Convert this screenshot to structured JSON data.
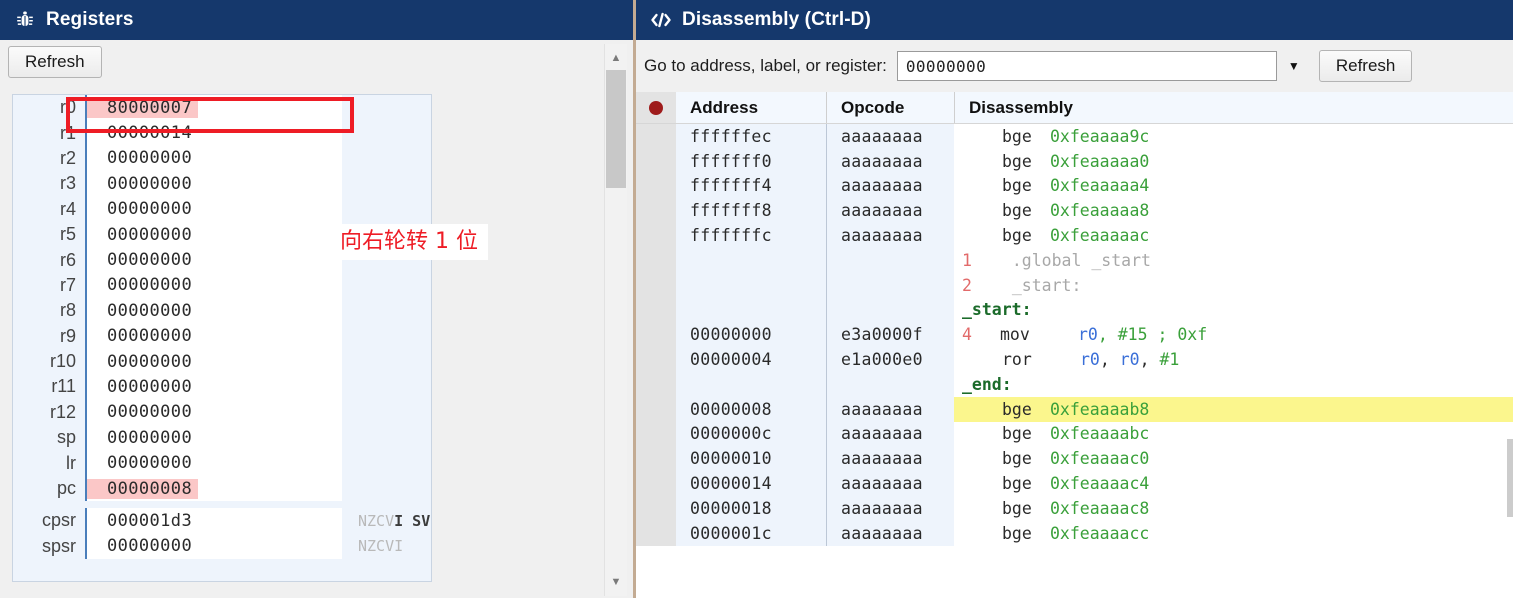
{
  "registers_panel": {
    "title": "Registers",
    "title_icon": "bug-icon",
    "refresh_label": "Refresh",
    "rows": [
      {
        "name": "r0",
        "value": "80000007",
        "highlight": true,
        "flags": ""
      },
      {
        "name": "r1",
        "value": "00000014",
        "highlight": false,
        "flags": ""
      },
      {
        "name": "r2",
        "value": "00000000",
        "highlight": false,
        "flags": ""
      },
      {
        "name": "r3",
        "value": "00000000",
        "highlight": false,
        "flags": ""
      },
      {
        "name": "r4",
        "value": "00000000",
        "highlight": false,
        "flags": ""
      },
      {
        "name": "r5",
        "value": "00000000",
        "highlight": false,
        "flags": ""
      },
      {
        "name": "r6",
        "value": "00000000",
        "highlight": false,
        "flags": ""
      },
      {
        "name": "r7",
        "value": "00000000",
        "highlight": false,
        "flags": ""
      },
      {
        "name": "r8",
        "value": "00000000",
        "highlight": false,
        "flags": ""
      },
      {
        "name": "r9",
        "value": "00000000",
        "highlight": false,
        "flags": ""
      },
      {
        "name": "r10",
        "value": "00000000",
        "highlight": false,
        "flags": ""
      },
      {
        "name": "r11",
        "value": "00000000",
        "highlight": false,
        "flags": ""
      },
      {
        "name": "r12",
        "value": "00000000",
        "highlight": false,
        "flags": ""
      },
      {
        "name": "sp",
        "value": "00000000",
        "highlight": false,
        "flags": ""
      },
      {
        "name": "lr",
        "value": "00000000",
        "highlight": false,
        "flags": ""
      },
      {
        "name": "pc",
        "value": "00000008",
        "highlight": true,
        "flags": ""
      },
      {
        "name": "cpsr",
        "value": "000001d3",
        "highlight": false,
        "flags_dim": "NZCV",
        "flags_set": "I",
        "flags_mode": "SVC"
      },
      {
        "name": "spsr",
        "value": "00000000",
        "highlight": false,
        "flags_dim": "NZCVI",
        "flags_set": "",
        "flags_mode": "?"
      }
    ],
    "scrollbar": {
      "up_arrow": "▲",
      "down_arrow": "▼"
    }
  },
  "disassembly_panel": {
    "title": "Disassembly (Ctrl-D)",
    "title_icon": "code-icon",
    "goto_label": "Go to address, label, or register:",
    "goto_value": "00000000",
    "goto_placeholder": "",
    "dropdown_caret": "▼",
    "refresh_label": "Refresh",
    "columns": {
      "breakpoint": "",
      "address": "Address",
      "opcode": "Opcode",
      "disassembly": "Disassembly"
    },
    "rows": [
      {
        "kind": "code",
        "address": "ffffffec",
        "opcode": "aaaaaaaa",
        "mnemonic": "bge",
        "operands": "0xfeaaaa9c",
        "highlight": false
      },
      {
        "kind": "code",
        "address": "fffffff0",
        "opcode": "aaaaaaaa",
        "mnemonic": "bge",
        "operands": "0xfeaaaaa0",
        "highlight": false
      },
      {
        "kind": "code",
        "address": "fffffff4",
        "opcode": "aaaaaaaa",
        "mnemonic": "bge",
        "operands": "0xfeaaaaa4",
        "highlight": false
      },
      {
        "kind": "code",
        "address": "fffffff8",
        "opcode": "aaaaaaaa",
        "mnemonic": "bge",
        "operands": "0xfeaaaaa8",
        "highlight": false
      },
      {
        "kind": "code",
        "address": "fffffffc",
        "opcode": "aaaaaaaa",
        "mnemonic": "bge",
        "operands": "0xfeaaaaac",
        "highlight": false
      },
      {
        "kind": "source",
        "address": "",
        "opcode": "",
        "lineno": "1",
        "text": ".global _start"
      },
      {
        "kind": "source",
        "address": "",
        "opcode": "",
        "lineno": "2",
        "text": "_start:"
      },
      {
        "kind": "label",
        "address": "",
        "opcode": "",
        "text": "_start:"
      },
      {
        "kind": "code-src",
        "address": "00000000",
        "opcode": "e3a0000f",
        "lineno": "4",
        "mnemonic": "mov",
        "operands_reg": "r0",
        "operands_rest": ", #15 ; 0xf",
        "highlight": false
      },
      {
        "kind": "code-ror",
        "address": "00000004",
        "opcode": "e1a000e0",
        "lineno": "",
        "mnemonic": "ror",
        "operands_reg1": "r0",
        "operands_reg2": "r0",
        "operands_imm": "#1",
        "highlight": false
      },
      {
        "kind": "label",
        "address": "",
        "opcode": "",
        "text": "_end:"
      },
      {
        "kind": "code",
        "address": "00000008",
        "opcode": "aaaaaaaa",
        "mnemonic": "bge",
        "operands": "0xfeaaaab8",
        "highlight": true
      },
      {
        "kind": "code",
        "address": "0000000c",
        "opcode": "aaaaaaaa",
        "mnemonic": "bge",
        "operands": "0xfeaaaabc",
        "highlight": false
      },
      {
        "kind": "code",
        "address": "00000010",
        "opcode": "aaaaaaaa",
        "mnemonic": "bge",
        "operands": "0xfeaaaac0",
        "highlight": false
      },
      {
        "kind": "code",
        "address": "00000014",
        "opcode": "aaaaaaaa",
        "mnemonic": "bge",
        "operands": "0xfeaaaac4",
        "highlight": false
      },
      {
        "kind": "code",
        "address": "00000018",
        "opcode": "aaaaaaaa",
        "mnemonic": "bge",
        "operands": "0xfeaaaac8",
        "highlight": false
      },
      {
        "kind": "code",
        "address": "0000001c",
        "opcode": "aaaaaaaa",
        "mnemonic": "bge",
        "operands": "0xfeaaaacc",
        "highlight": false
      }
    ]
  },
  "annotations": {
    "note_text": "向右轮转 1 位",
    "color": "#ee1c25"
  },
  "colors": {
    "titlebar": "#15386c",
    "highlight_row": "#fbf68d",
    "register_highlight": "#fbc7c7",
    "annotation": "#ee1c25",
    "branch_target": "#3aa03a",
    "register_operand": "#3a6fd8"
  }
}
